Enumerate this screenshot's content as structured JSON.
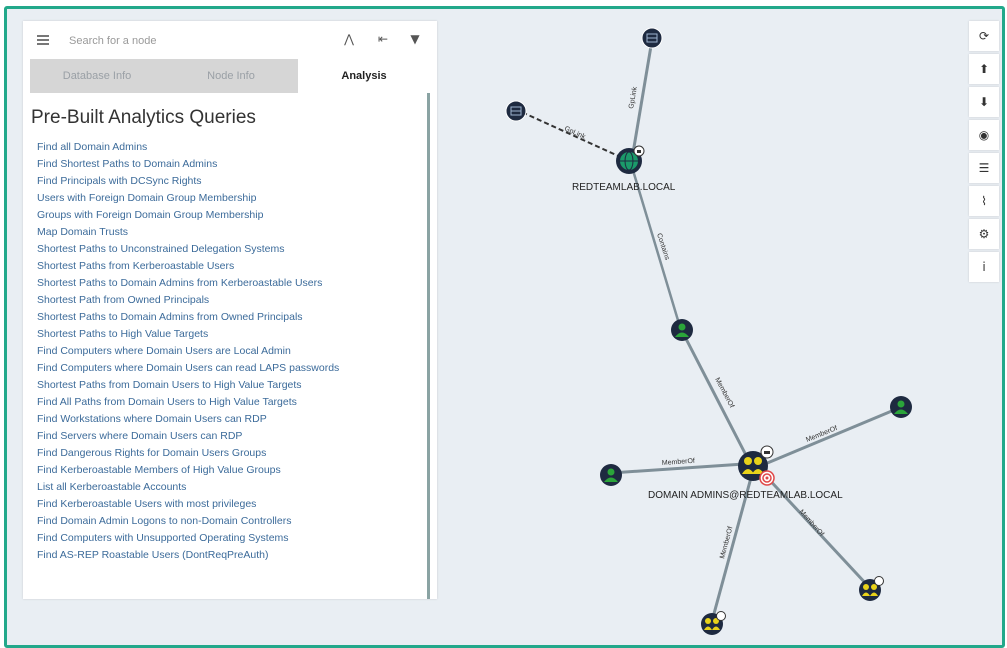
{
  "search": {
    "placeholder": "Search for a node"
  },
  "tabs": [
    {
      "label": "Database Info",
      "active": false
    },
    {
      "label": "Node Info",
      "active": false
    },
    {
      "label": "Analysis",
      "active": true
    }
  ],
  "analysis": {
    "title": "Pre-Built Analytics Queries",
    "queries": [
      "Find all Domain Admins",
      "Find Shortest Paths to Domain Admins",
      "Find Principals with DCSync Rights",
      "Users with Foreign Domain Group Membership",
      "Groups with Foreign Domain Group Membership",
      "Map Domain Trusts",
      "Shortest Paths to Unconstrained Delegation Systems",
      "Shortest Paths from Kerberoastable Users",
      "Shortest Paths to Domain Admins from Kerberoastable Users",
      "Shortest Path from Owned Principals",
      "Shortest Paths to Domain Admins from Owned Principals",
      "Shortest Paths to High Value Targets",
      "Find Computers where Domain Users are Local Admin",
      "Find Computers where Domain Users can read LAPS passwords",
      "Shortest Paths from Domain Users to High Value Targets",
      "Find All Paths from Domain Users to High Value Targets",
      "Find Workstations where Domain Users can RDP",
      "Find Servers where Domain Users can RDP",
      "Find Dangerous Rights for Domain Users Groups",
      "Find Kerberoastable Members of High Value Groups",
      "List all Kerberoastable Accounts",
      "Find Kerberoastable Users with most privileges",
      "Find Domain Admin Logons to non-Domain Controllers",
      "Find Computers with Unsupported Operating Systems",
      "Find AS-REP Roastable Users (DontReqPreAuth)"
    ]
  },
  "toolbar": [
    {
      "icon": "refresh-icon",
      "glyph": "⟳"
    },
    {
      "icon": "export-icon",
      "glyph": "⬆"
    },
    {
      "icon": "import-icon",
      "glyph": "⬇"
    },
    {
      "icon": "upload-icon",
      "glyph": "◉"
    },
    {
      "icon": "queries-list-icon",
      "glyph": "☰"
    },
    {
      "icon": "chart-icon",
      "glyph": "⌇"
    },
    {
      "icon": "settings-icon",
      "glyph": "⚙"
    },
    {
      "icon": "info-icon",
      "glyph": "i"
    }
  ],
  "graph": {
    "labels": {
      "domain": "REDTEAMLAB.LOCAL",
      "group": "DOMAIN ADMINS@REDTEAMLAB.LOCAL"
    },
    "edges": {
      "gplink_top": "GpLink",
      "gplink_left": "GpLink",
      "contains": "Contains",
      "memberof_1": "MemberOf",
      "memberof_2": "MemberOf",
      "memberof_3": "MemberOf",
      "memberof_4": "MemberOf",
      "memberof_5": "MemberOf"
    },
    "colors": {
      "gpo": "#1e2a40",
      "domain": "#1b9a6a",
      "user": "#2ba53a",
      "group": "#e8d21a",
      "target": "#e04848"
    }
  }
}
